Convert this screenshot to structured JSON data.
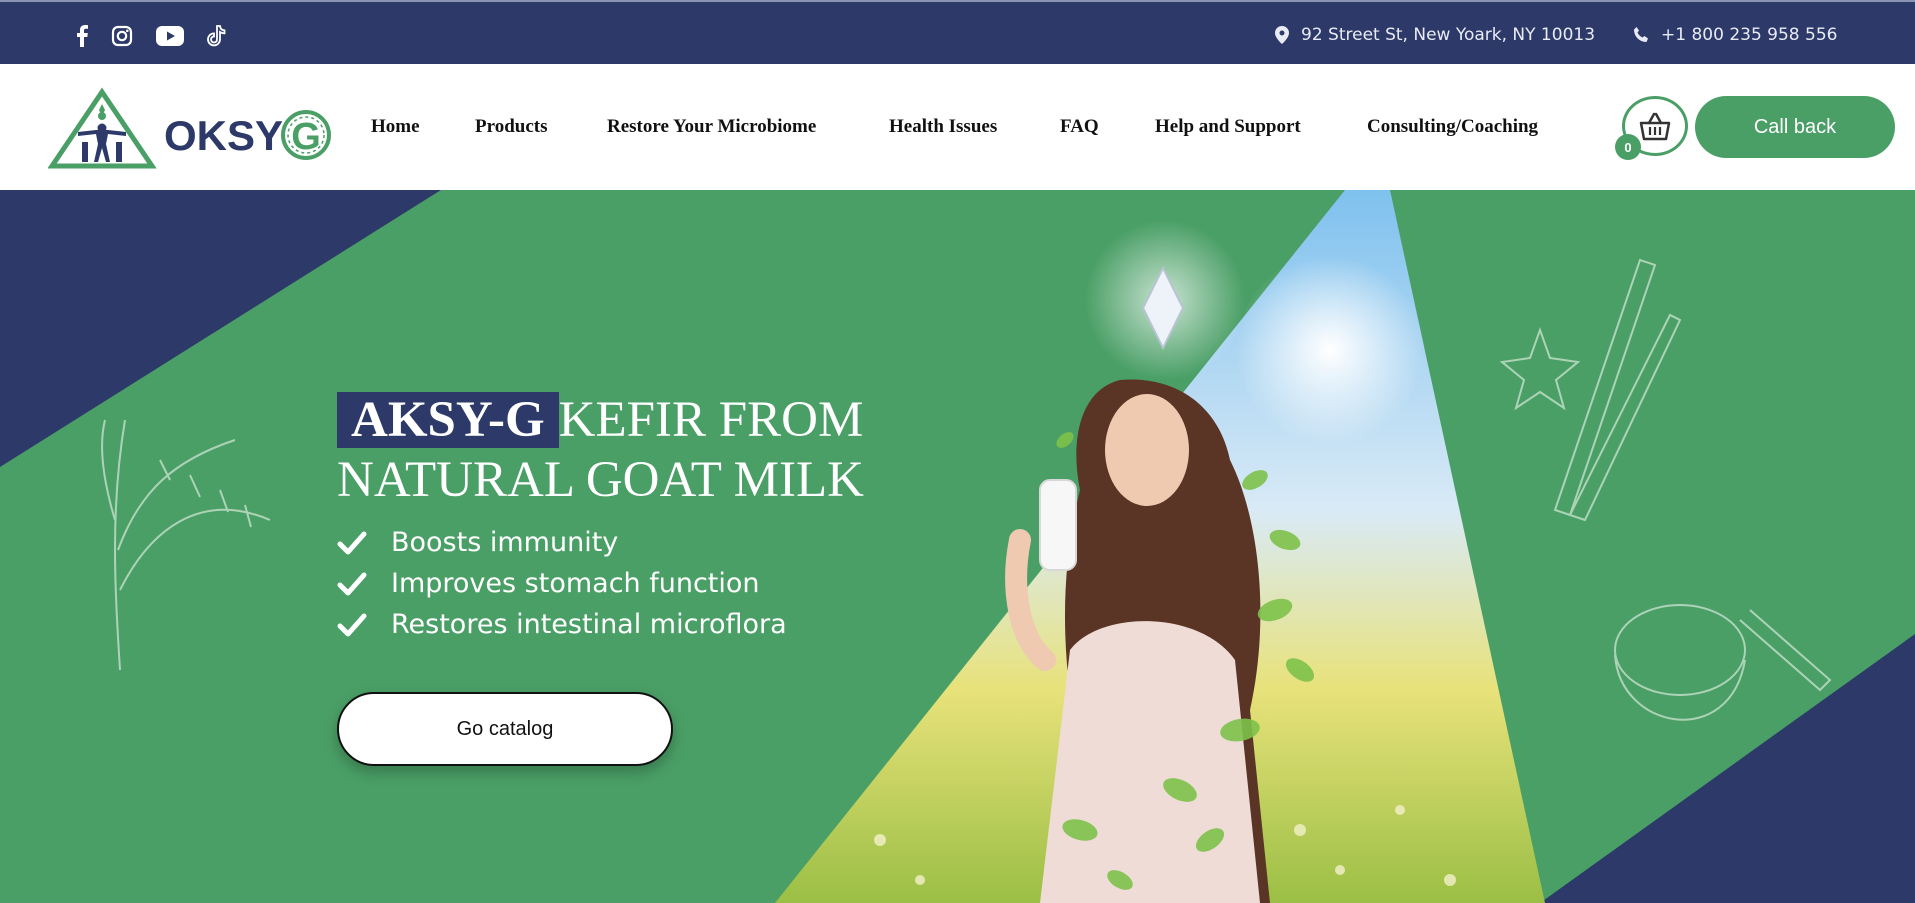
{
  "topbar": {
    "social": [
      {
        "icon": "facebook-icon"
      },
      {
        "icon": "instagram-icon"
      },
      {
        "icon": "youtube-icon"
      },
      {
        "icon": "tiktok-icon"
      }
    ],
    "address": "92 Street St, New Yoark, NY 10013",
    "phone": "+1 800 235 958 556"
  },
  "header": {
    "logo_text": "OKSY",
    "logo_letter": "G",
    "nav": [
      {
        "label": "Home"
      },
      {
        "label": "Products"
      },
      {
        "label": "Restore Your Microbiome"
      },
      {
        "label": "Health Issues"
      },
      {
        "label": "FAQ"
      },
      {
        "label": "Help and Support"
      },
      {
        "label": "Consulting/Coaching"
      }
    ],
    "cart_count": "0",
    "callback_label": "Call back"
  },
  "hero": {
    "brand": "AKSY-G",
    "title_rest": "KEFIR FROM",
    "title_line2": "NATURAL GOAT MILK",
    "benefits": [
      "Boosts immunity",
      "Improves stomach function",
      "Restores intestinal microflora"
    ],
    "cta_label": "Go catalog"
  },
  "colors": {
    "navy": "#2d3a69",
    "green": "#4a9f66",
    "white": "#ffffff"
  }
}
